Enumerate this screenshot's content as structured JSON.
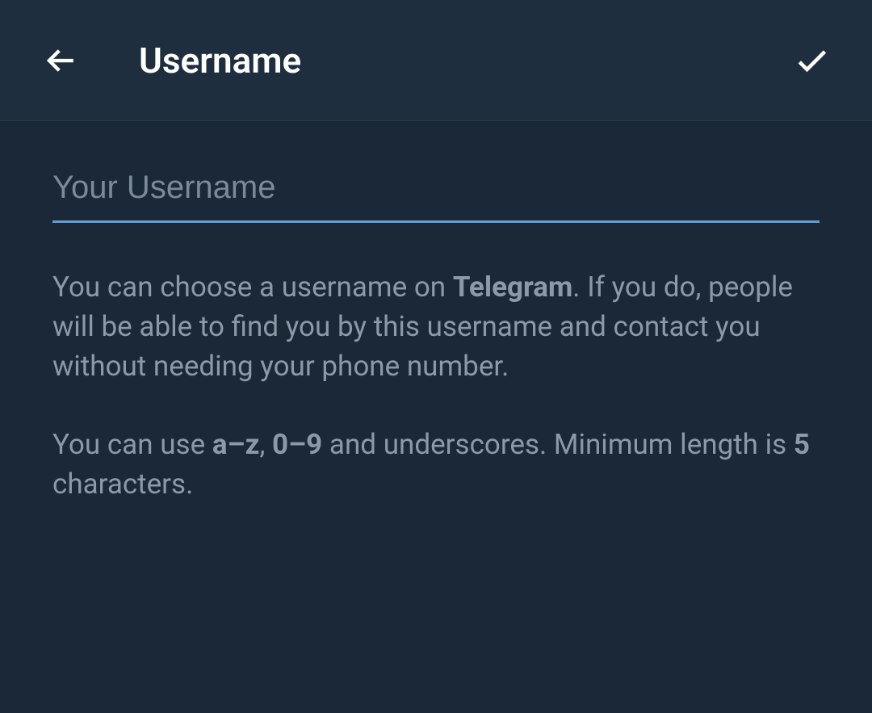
{
  "header": {
    "title": "Username"
  },
  "input": {
    "placeholder": "Your Username",
    "value": ""
  },
  "help": {
    "p1_part1": "You can choose a username on ",
    "p1_bold1": "Telegram",
    "p1_part2": ". If you do, people will be able to find you by this username and contact you without needing your phone number.",
    "p2_part1": "You can use ",
    "p2_bold1": "a–z",
    "p2_part2": ", ",
    "p2_bold2": "0–9",
    "p2_part3": " and underscores. Minimum length is ",
    "p2_bold3": "5",
    "p2_part4": " characters."
  }
}
